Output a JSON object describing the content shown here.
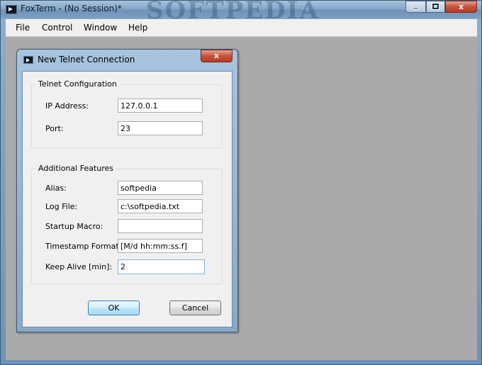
{
  "window": {
    "title": "FoxTerm - (No Session)*",
    "watermark": "SOFTPEDIA"
  },
  "window_controls": {
    "close_label": "x"
  },
  "menu": {
    "items": [
      "File",
      "Control",
      "Window",
      "Help"
    ]
  },
  "dialog": {
    "title": "New Telnet Connection",
    "close_label": "x",
    "telnet_config": {
      "legend": "Telnet Configuration",
      "ip_label": "IP Address:",
      "ip_value": "127.0.0.1",
      "port_label": "Port:",
      "port_value": "23"
    },
    "additional": {
      "legend": "Additional Features",
      "alias_label": "Alias:",
      "alias_value": "softpedia",
      "logfile_label": "Log File:",
      "logfile_value": "c:\\softpedia.txt",
      "macro_label": "Startup Macro:",
      "macro_value": "",
      "timestamp_label": "Timestamp Format:",
      "timestamp_value": "[M/d hh:mm:ss.f]",
      "keepalive_label": "Keep Alive [min]:",
      "keepalive_value": "2"
    },
    "ok_label": "OK",
    "cancel_label": "Cancel"
  }
}
